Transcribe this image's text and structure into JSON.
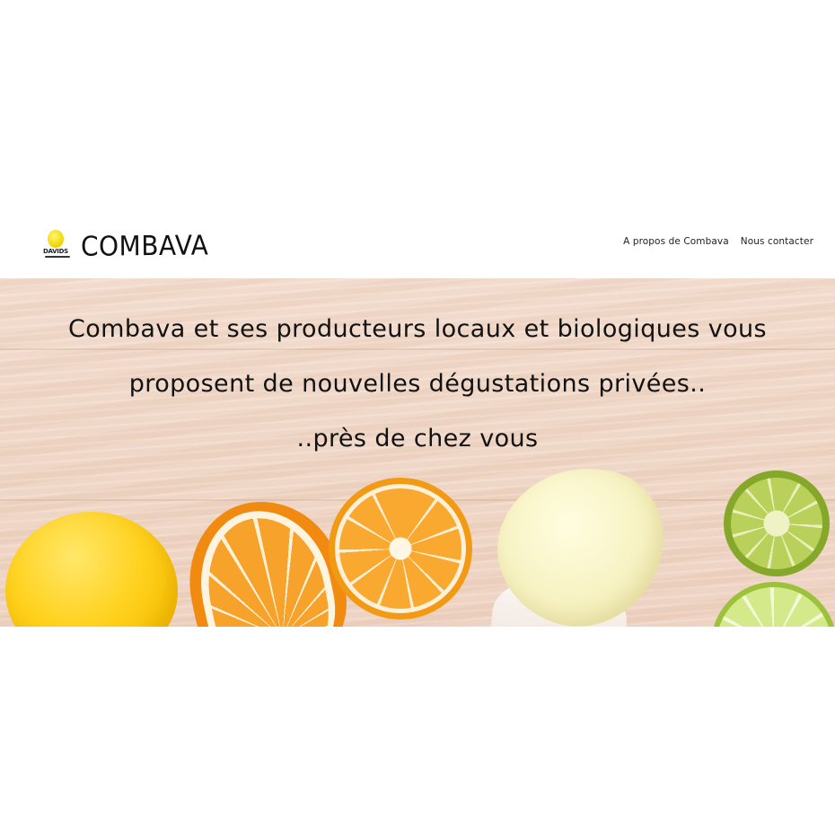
{
  "header": {
    "logo": {
      "icon": "lemon-logo-icon",
      "text": "DAVIDS"
    },
    "brand_name": "COMBAVA",
    "nav": [
      {
        "label": "A propos de Combava"
      },
      {
        "label": "Nous contacter"
      }
    ]
  },
  "hero": {
    "lines": [
      "Combava et ses producteurs locaux et biologiques vous",
      "proposent de nouvelles dégustations privées..",
      "..près de chez vous"
    ]
  },
  "colors": {
    "background": "#ffffff",
    "wood": "#f1d8c8",
    "text": "#121212",
    "lemon": "#ffd21f",
    "orange": "#f39a14",
    "lime": "#9cc13a"
  }
}
